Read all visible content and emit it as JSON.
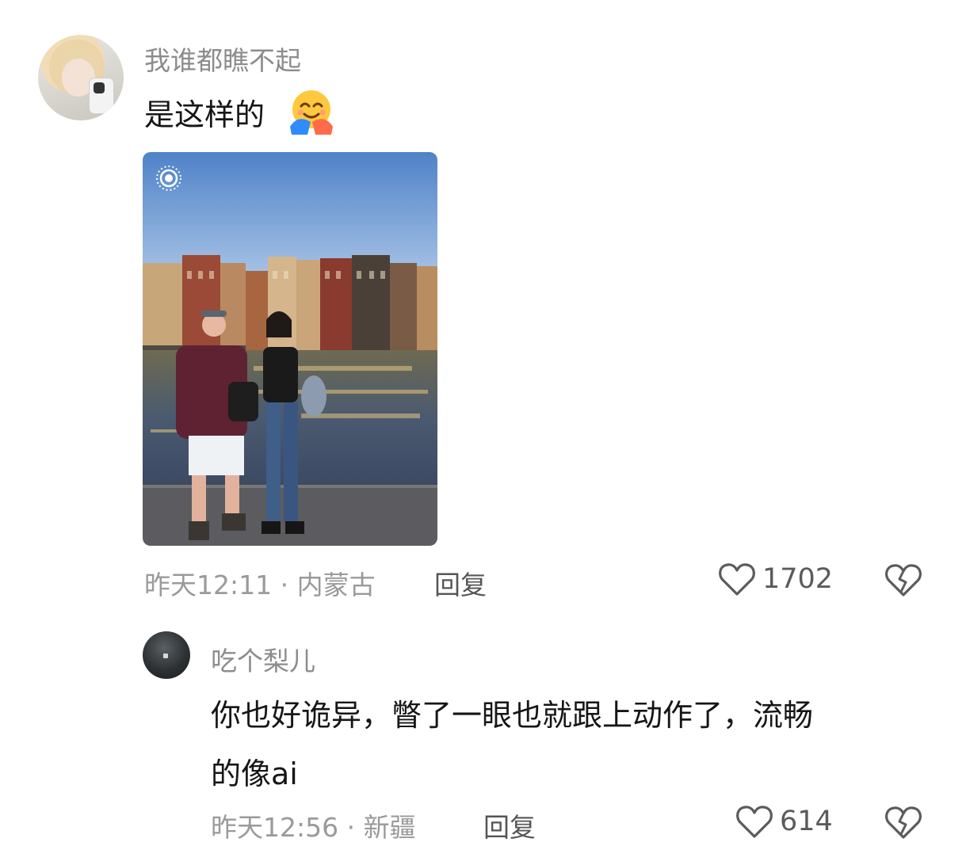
{
  "comment": {
    "username": "我谁都瞧不起",
    "text": "是这样的",
    "emoji_icon": "hugging-face-emoji",
    "meta": "昨天12:11 · 内蒙古",
    "reply_label": "回复",
    "likes": "1702"
  },
  "reply": {
    "username": "吃个梨儿",
    "text_line1": "你也好诡异，瞥了一眼也就跟上动作了，流畅",
    "text_line2": "的像ai",
    "meta": "昨天12:56 · 新疆",
    "reply_label": "回复",
    "likes": "614"
  },
  "icons": {
    "like": "heart-outline-icon",
    "dislike": "broken-heart-icon",
    "live_photo": "live-photo-icon"
  },
  "colors": {
    "username": "#8c8c8c",
    "text": "#161616",
    "meta": "#9a9a9a"
  }
}
